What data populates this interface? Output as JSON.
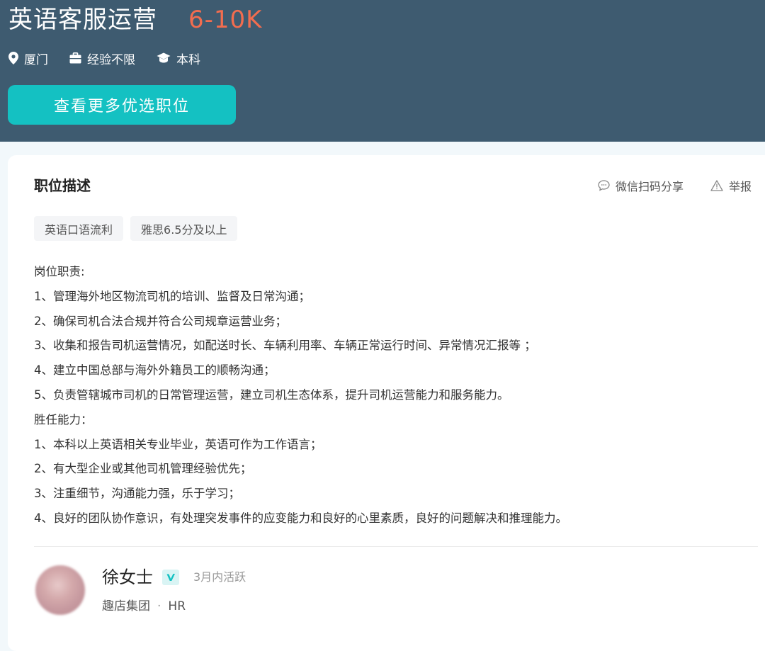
{
  "header": {
    "title": "英语客服运营",
    "salary": "6-10K",
    "meta": {
      "location": "厦门",
      "experience": "经验不限",
      "education": "本科"
    },
    "more_button": "查看更多优选职位"
  },
  "description": {
    "section_title": "职位描述",
    "actions": {
      "share": "微信扫码分享",
      "report": "举报"
    },
    "tags": [
      "英语口语流利",
      "雅思6.5分及以上"
    ],
    "lines": [
      "岗位职责:",
      "1、管理海外地区物流司机的培训、监督及日常沟通；",
      "2、确保司机合法合规并符合公司规章运营业务；",
      "3、收集和报告司机运营情况，如配送时长、车辆利用率、车辆正常运行时间、异常情况汇报等 ；",
      "4、建立中国总部与海外外籍员工的顺畅沟通；",
      "5、负责管辖城市司机的日常管理运营，建立司机生态体系，提升司机运营能力和服务能力。",
      "胜任能力：",
      "1、本科以上英语相关专业毕业，英语可作为工作语言；",
      "2、有大型企业或其他司机管理经验优先；",
      "3、注重细节，沟通能力强，乐于学习；",
      "4、良好的团队协作意识，有处理突发事件的应变能力和良好的心里素质，良好的问题解决和推理能力。"
    ]
  },
  "recruiter": {
    "name": "徐女士",
    "active": "3月内活跃",
    "company": "趣店集团",
    "role": "HR"
  },
  "colors": {
    "header_bg": "#3e5b70",
    "salary": "#f26d4f",
    "accent": "#14c1c2"
  }
}
